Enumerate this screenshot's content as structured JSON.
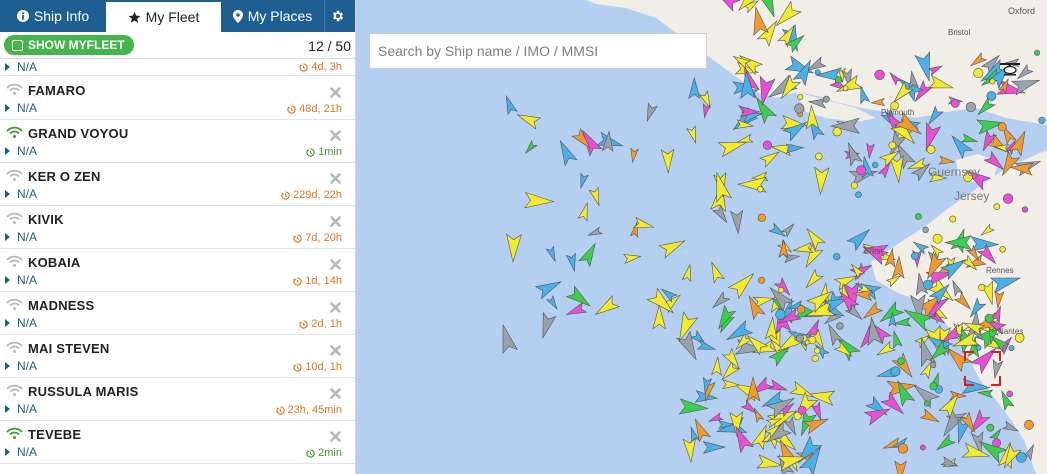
{
  "tabs": [
    {
      "label": "Ship Info",
      "icon": "info-icon"
    },
    {
      "label": "My Fleet",
      "icon": "star-icon"
    },
    {
      "label": "My Places",
      "icon": "map-marker-icon"
    },
    {
      "label": "",
      "icon": "gear-icon"
    }
  ],
  "toolbar": {
    "show_label": "SHOW MYFLEET",
    "count": "12 / 50"
  },
  "partial_row": {
    "status": "N/A",
    "age": "4d, 3h"
  },
  "ships": [
    {
      "name": "FAMARO",
      "status": "N/A",
      "age": "48d, 21h",
      "online": false
    },
    {
      "name": "GRAND VOYOU",
      "status": "N/A",
      "age": "1min",
      "online": true
    },
    {
      "name": "KER O ZEN",
      "status": "N/A",
      "age": "229d, 22h",
      "online": false
    },
    {
      "name": "KIVIK",
      "status": "N/A",
      "age": "7d, 20h",
      "online": false
    },
    {
      "name": "KOBAIA",
      "status": "N/A",
      "age": "1d, 14h",
      "online": false
    },
    {
      "name": "MADNESS",
      "status": "N/A",
      "age": "2d, 1h",
      "online": false
    },
    {
      "name": "MAI STEVEN",
      "status": "N/A",
      "age": "10d, 1h",
      "online": false
    },
    {
      "name": "RUSSULA MARIS",
      "status": "N/A",
      "age": "23h, 45min",
      "online": false
    },
    {
      "name": "TEVEBE",
      "status": "N/A",
      "age": "2min",
      "online": true
    }
  ],
  "search": {
    "placeholder": "Search by Ship name / IMO / MMSI"
  },
  "map": {
    "places": [
      "Oxford",
      "Bristol",
      "Plymouth",
      "Guernsey",
      "Jersey",
      "Brest",
      "Rennes",
      "Nantes"
    ]
  },
  "colors": {
    "header": "#1e5e91",
    "button_green": "#44b54a",
    "age_old": "#e8731c",
    "age_fresh": "#3f9b2d",
    "sea": "#b5cff0",
    "land": "#f1eee8"
  }
}
